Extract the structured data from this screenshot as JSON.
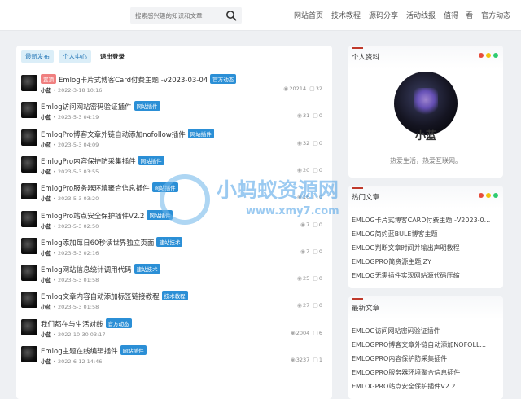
{
  "search": {
    "placeholder": "搜索感兴趣的知识和文章"
  },
  "nav": [
    "网站首页",
    "技术教程",
    "源码分享",
    "活动线报",
    "值得一看",
    "官方动态"
  ],
  "tabs": [
    "最新发布",
    "个人中心",
    "退出登录"
  ],
  "posts": [
    {
      "badge": "置顶",
      "title": "Emlog卡片式博客Card付费主题 -v2023-03-04",
      "tag": "官方动态",
      "author": "小蓝",
      "date": "2022-3-18 10:16",
      "views": "20214",
      "comments": "32"
    },
    {
      "badge": "",
      "title": "Emlog访问网站密码验证插件",
      "tag": "网站插件",
      "author": "小蓝",
      "date": "2023-5-3 04:19",
      "views": "31",
      "comments": "0"
    },
    {
      "badge": "",
      "title": "EmlogPro博客文章外链自动添加nofollow插件",
      "tag": "网站插件",
      "author": "小蓝",
      "date": "2023-5-3 04:09",
      "views": "32",
      "comments": "0"
    },
    {
      "badge": "",
      "title": "EmlogPro内容保护防采集插件",
      "tag": "网站插件",
      "author": "小蓝",
      "date": "2023-5-3 03:55",
      "views": "20",
      "comments": "0"
    },
    {
      "badge": "",
      "title": "EmlogPro服务器环境聚合信息插件",
      "tag": "网站插件",
      "author": "小蓝",
      "date": "2023-5-3 03:20",
      "views": "16",
      "comments": "0"
    },
    {
      "badge": "",
      "title": "EmlogPro站点安全保护插件V2.2",
      "tag": "网站插件",
      "author": "小蓝",
      "date": "2023-5-3 02:50",
      "views": "7",
      "comments": "0"
    },
    {
      "badge": "",
      "title": "Emlog添加每日60秒读世界独立页面",
      "tag": "建站技术",
      "author": "小蓝",
      "date": "2023-5-3 02:16",
      "views": "7",
      "comments": "0"
    },
    {
      "badge": "",
      "title": "Emlog网站信息统计调用代码",
      "tag": "建站技术",
      "author": "小蓝",
      "date": "2023-5-3 01:58",
      "views": "25",
      "comments": "0"
    },
    {
      "badge": "",
      "title": "Emlog文章内容自动添加标签链接教程",
      "tag": "技术教程",
      "author": "小蓝",
      "date": "2023-5-3 01:58",
      "views": "27",
      "comments": "0"
    },
    {
      "badge": "",
      "title": "我们都在与生活对线",
      "tag": "官方动态",
      "author": "小蓝",
      "date": "2022-10-30 03:17",
      "views": "2004",
      "comments": "6"
    },
    {
      "badge": "",
      "title": "Emlog主题在线编辑插件",
      "tag": "网站插件",
      "author": "小蓝",
      "date": "2022-6-12 14:46",
      "views": "3237",
      "comments": "1"
    }
  ],
  "profile": {
    "heading": "个人资料",
    "name": "小蓝",
    "bio": "热爱生活，热爱互联网。"
  },
  "hot": {
    "heading": "热门文章",
    "items": [
      "EMLOG卡片式博客CARD付费主题 -V2023-0...",
      "EMLOG简约蓝BULE博客主题",
      "EMLOG判断文章时间并输出声明教程",
      "EMLOGPRO简资源主题JZY",
      "EMLOG无需插件实现网站源代码压缩"
    ]
  },
  "latest": {
    "heading": "最新文章",
    "items": [
      "EMLOG访问网站密码验证插件",
      "EMLOGPRO博客文章外链自动添加NOFOLL...",
      "EMLOGPRO内容保护防采集插件",
      "EMLOGPRO服务器环境聚合信息插件",
      "EMLOGPRO站点安全保护插件V2.2"
    ]
  },
  "watermark": {
    "title": "小蚂蚁资源网",
    "url": "www.xmy7.com"
  },
  "colors": {
    "accent": "#2b8fd6",
    "top_badge": "#f08080",
    "dot_red": "#e74c3c",
    "dot_yellow": "#f1c40f",
    "dot_green": "#2ecc71"
  },
  "icons": {
    "search": "search-icon",
    "views": "eye-icon",
    "comments": "comment-icon"
  }
}
